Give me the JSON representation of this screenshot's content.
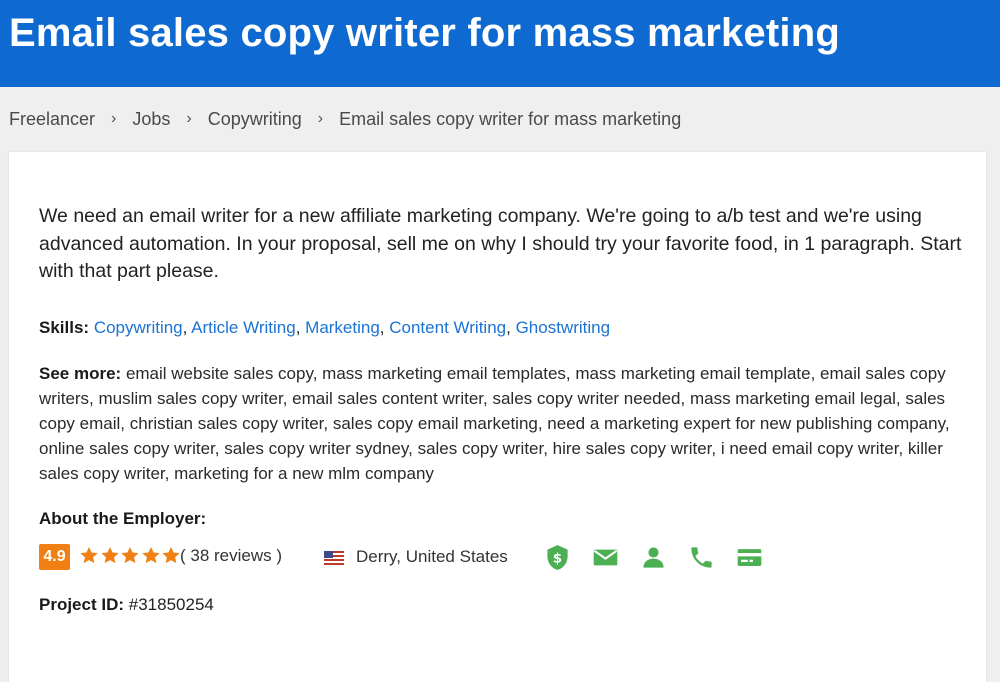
{
  "header": {
    "title": "Email sales copy writer for mass marketing"
  },
  "breadcrumb": {
    "items": [
      "Freelancer",
      "Jobs",
      "Copywriting",
      "Email sales copy writer for mass marketing"
    ],
    "separator": "›"
  },
  "job": {
    "description": "We need an email writer for a new affiliate marketing company. We're going to a/b test and we're using advanced automation. In your proposal, sell me on why I should try your favorite food, in 1 paragraph. Start with that part please.",
    "skills_label": "Skills:",
    "skills": [
      "Copywriting",
      "Article Writing",
      "Marketing",
      "Content Writing",
      "Ghostwriting"
    ],
    "see_more_label": "See more:",
    "see_more_text": "email website sales copy, mass marketing email templates, mass marketing email template, email sales copy writers, muslim sales copy writer, email sales content writer, sales copy writer needed, mass marketing email legal, sales copy email, christian sales copy writer, sales copy email marketing, need a marketing expert for new publishing company, online sales copy writer, sales copy writer sydney, sales copy writer, hire sales copy writer, i need email copy writer, killer sales copy writer, marketing for a new mlm company"
  },
  "employer": {
    "about_label": "About the Employer:",
    "rating": "4.9",
    "stars": 5,
    "reviews": "( 38 reviews )",
    "location": "Derry, United States",
    "verifications": [
      "payment-verified-icon",
      "email-verified-icon",
      "profile-verified-icon",
      "phone-verified-icon",
      "deposit-verified-icon"
    ]
  },
  "project": {
    "label": "Project ID:",
    "id": "#31850254"
  },
  "colors": {
    "header_bg": "#0e6ad0",
    "link": "#1b73d3",
    "rating_badge": "#f07f14",
    "star": "#f07f14",
    "verified_green": "#4cb053"
  }
}
